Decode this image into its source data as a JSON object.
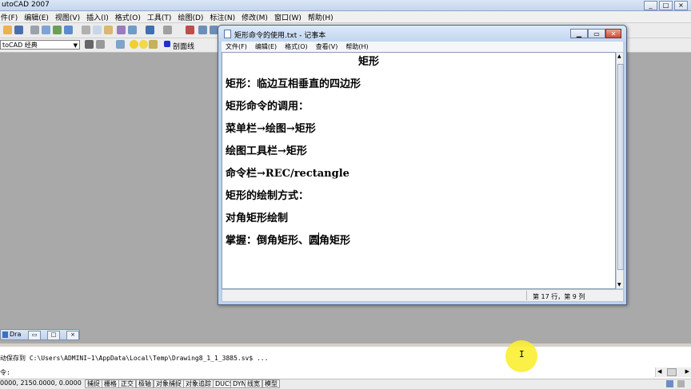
{
  "app": {
    "title": "utoCAD 2007",
    "window_buttons": [
      "_",
      "□",
      "×"
    ]
  },
  "menu": [
    "编辑(E)",
    "视图(V)",
    "插入(I)",
    "格式(O)",
    "工具(T)",
    "绘图(D)",
    "标注(N)",
    "修改(M)",
    "窗口(W)",
    "帮助(H)"
  ],
  "menu_partial_first": "件(F)",
  "toolbar": {
    "workspace": "toCAD 经典",
    "layer_label": "剖面线"
  },
  "drawing_tab": {
    "label": "Dra"
  },
  "notepad": {
    "title": "矩形命令的使用.txt - 记事本",
    "menu": [
      "文件(F)",
      "编辑(E)",
      "格式(O)",
      "查看(V)",
      "帮助(H)"
    ],
    "lines": [
      "矩形",
      "矩形：临边互相垂直的四边形",
      "矩形命令的调用：",
      "菜单栏→绘图→矩形",
      "绘图工具栏→矩形",
      "命令栏→REC/rectangle",
      "矩形的绘制方式：",
      "对角矩形绘制",
      "掌握：倒角矩形、圆角矩形"
    ],
    "status": "第 17 行，第 9 列"
  },
  "command": {
    "line1": "动保存到 C:\\Users\\ADMINI~1\\AppData\\Local\\Temp\\Drawing8_1_1_3885.sv$ ...",
    "line2": "令:"
  },
  "statusbar": {
    "coords": "0000,   2150.0000, 0.0000",
    "buttons": [
      "捕捉",
      "栅格",
      "正交",
      "极轴",
      "对象捕捉",
      "对象追踪",
      "DUCS",
      "DYN",
      "线宽",
      "模型"
    ]
  }
}
